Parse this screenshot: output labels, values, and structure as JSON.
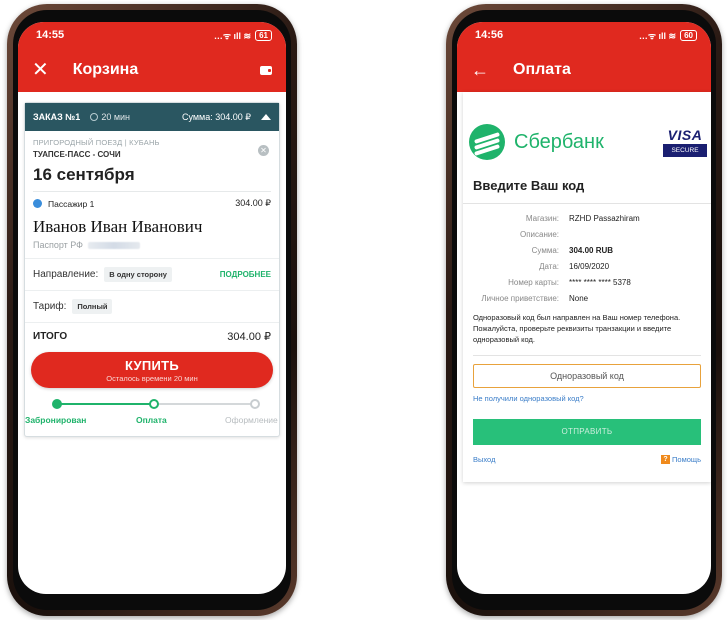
{
  "left": {
    "status": {
      "time": "14:55",
      "battery": "61"
    },
    "appbar": {
      "title": "Корзина"
    },
    "order": {
      "number": "ЗАКАЗ №1",
      "time": "20 мин",
      "sum": "Сумма: 304.00 ₽"
    },
    "train": {
      "type": "ПРИГОРОДНЫЙ ПОЕЗД | КУБАНЬ",
      "route": "ТУАПСЕ-ПАСС - СОЧИ",
      "date": "16 сентября"
    },
    "passenger": {
      "label": "Пассажир 1",
      "price": "304.00 ₽",
      "name": "Иванов Иван Иванович",
      "passport_label": "Паспорт РФ"
    },
    "direction": {
      "label": "Направление:",
      "value": "В одну сторону",
      "more": "ПОДРОБНЕЕ"
    },
    "tariff": {
      "label": "Тариф:",
      "value": "Полный"
    },
    "total": {
      "label": "ИТОГО",
      "value": "304.00 ₽"
    },
    "buy": {
      "label": "КУПИТЬ",
      "sub": "Осталось времени 20 мин"
    },
    "steps": [
      {
        "label": "Забронирован"
      },
      {
        "label": "Оплата"
      },
      {
        "label": "Оформление"
      }
    ]
  },
  "right": {
    "status": {
      "time": "14:56",
      "battery": "60"
    },
    "appbar": {
      "title": "Оплата"
    },
    "bank": {
      "name": "Сбербанк",
      "visa": "VISA",
      "secure": "SECURE"
    },
    "title": "Введите Ваш код",
    "details": [
      {
        "label": "Магазин:",
        "value": "RZHD Passazhiram"
      },
      {
        "label": "Описание:",
        "value": ""
      },
      {
        "label": "Сумма:",
        "value": "304.00 RUB"
      },
      {
        "label": "Дата:",
        "value": "16/09/2020"
      },
      {
        "label": "Номер карты:",
        "value": "**** **** **** 5378"
      },
      {
        "label": "Личное приветствие:",
        "value": "None"
      }
    ],
    "info": "Одноразовый код был направлен на Ваш номер телефона. Пожалуйста, проверьте реквизиты транзакции и введите одноразовый код.",
    "otp_placeholder": "Одноразовый код",
    "resend": "Не получили одноразовый код?",
    "send": "ОТПРАВИТЬ",
    "exit": "Выход",
    "help": "Помощь"
  },
  "colors": {
    "brand_red": "#e0291f",
    "header_teal": "#2a5661",
    "sber_green": "#1fb36b",
    "link_blue": "#3a7dc8"
  },
  "icons": [
    "close-icon",
    "wallet-icon",
    "clock-icon",
    "chevron-up-icon",
    "remove-icon",
    "back-arrow-icon",
    "sberbank-logo-icon",
    "help-icon"
  ]
}
